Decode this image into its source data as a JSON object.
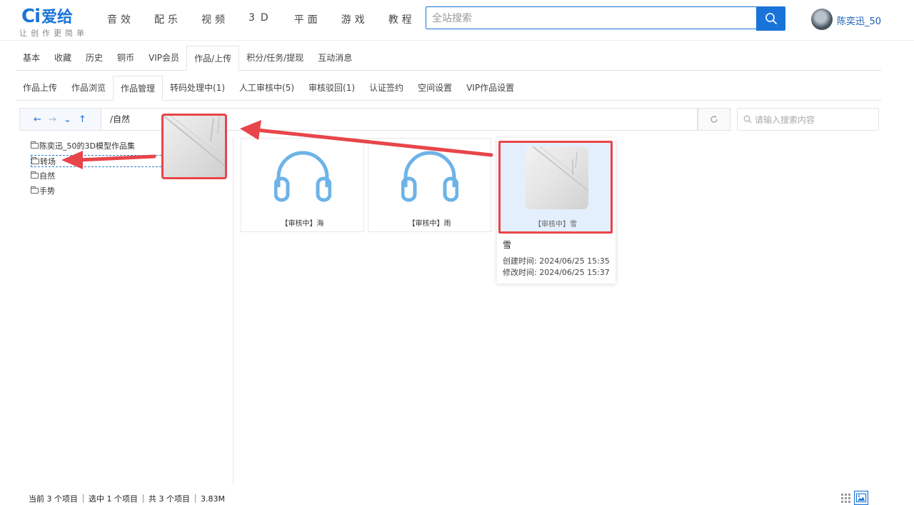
{
  "header": {
    "logo_mark": "Ci",
    "logo_text": "爱给",
    "slogan": "让创作更简单",
    "nav": [
      "音效",
      "配乐",
      "视频",
      "3D",
      "平面",
      "游戏",
      "教程"
    ],
    "search_placeholder": "全站搜索",
    "username": "陈奕迅_50"
  },
  "tabs_primary": {
    "items": [
      "基本",
      "收藏",
      "历史",
      "铜币",
      "VIP会员",
      "作品/上传",
      "积分/任务/提现",
      "互动消息"
    ],
    "active": "作品/上传"
  },
  "tabs_secondary": {
    "items": [
      "作品上传",
      "作品浏览",
      "作品管理",
      "转码处理中(1)",
      "人工审核中(5)",
      "审核驳回(1)",
      "认证签约",
      "空间设置",
      "VIP作品设置"
    ],
    "active": "作品管理"
  },
  "pathbar": {
    "path": "/自然",
    "search_placeholder": "请输入搜索内容"
  },
  "tree": {
    "items": [
      "陈奕迅_50的3D模型作品集",
      "转场",
      "自然",
      "手势"
    ]
  },
  "files": [
    {
      "caption": "【审核中】海",
      "icon": "headphone-icon"
    },
    {
      "caption": "【审核中】雨",
      "icon": "headphone-icon"
    },
    {
      "caption": "【审核中】雪",
      "icon": "image-thumbnail"
    }
  ],
  "tooltip": {
    "name": "雪",
    "created": "创建时间: 2024/06/25 15:35",
    "modified": "修改时间: 2024/06/25 15:37"
  },
  "status": {
    "current": "当前 3 个项目",
    "selected": "选中 1 个项目",
    "total": "共 3 个项目",
    "size": "3.83M"
  },
  "colors": {
    "brand": "#1a73d9",
    "annotation": "#e8454a",
    "selected_bg": "#e3effc",
    "icon_blue": "#6db3e8"
  }
}
